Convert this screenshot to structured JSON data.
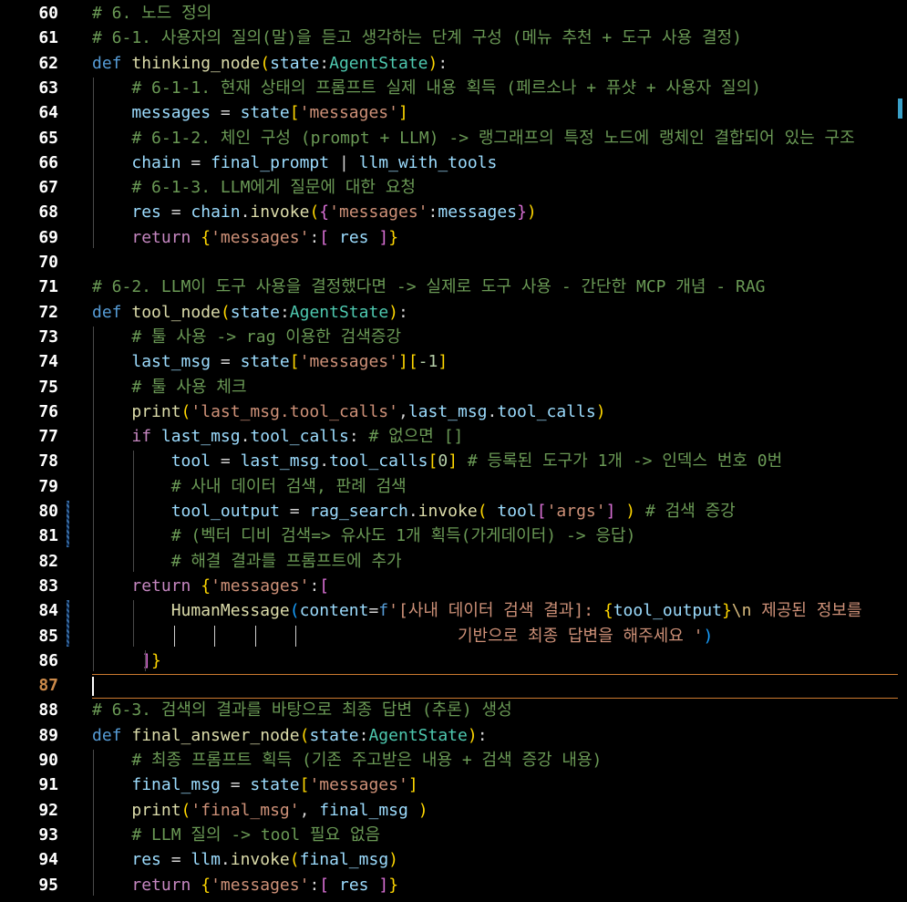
{
  "colors": {
    "background": "#000000",
    "comment": "#6a9955",
    "keyword": "#569cd6",
    "control": "#c586c0",
    "function": "#dcdcaa",
    "variable": "#9cdcfe",
    "class": "#4ec9b0",
    "string": "#ce9178",
    "number": "#b5cea8",
    "current_line_number": "#cc8a4a"
  },
  "editor": {
    "current_line": "87",
    "lines": [
      {
        "n": "60",
        "t": [
          [
            "cm",
            "# 6. 노드 정의"
          ]
        ]
      },
      {
        "n": "61",
        "t": [
          [
            "cm",
            "# 6-1. 사용자의 질의(말)을 듣고 생각하는 단계 구성 (메뉴 추천 + 도구 사용 결정)"
          ]
        ]
      },
      {
        "n": "62",
        "t": [
          [
            "kw",
            "def"
          ],
          [
            "pn",
            " "
          ],
          [
            "fn",
            "thinking_node"
          ],
          [
            "br1",
            "("
          ],
          [
            "vr",
            "state"
          ],
          [
            "pn",
            ":"
          ],
          [
            "cl",
            "AgentState"
          ],
          [
            "br1",
            ")"
          ],
          [
            "pn",
            ":"
          ]
        ]
      },
      {
        "n": "63",
        "t": [
          [
            "pn",
            "    "
          ],
          [
            "cm",
            "# 6-1-1. 현재 상태의 프롬프트 실제 내용 획득 (페르소나 + 퓨샷 + 사용자 질의)"
          ]
        ]
      },
      {
        "n": "64",
        "t": [
          [
            "pn",
            "    "
          ],
          [
            "vr",
            "messages"
          ],
          [
            "pn",
            " = "
          ],
          [
            "vr",
            "state"
          ],
          [
            "br1",
            "["
          ],
          [
            "st",
            "'messages'"
          ],
          [
            "br1",
            "]"
          ]
        ]
      },
      {
        "n": "65",
        "t": [
          [
            "pn",
            "    "
          ],
          [
            "cm",
            "# 6-1-2. 체인 구성 (prompt + LLM) -> 랭그래프의 특정 노드에 랭체인 결합되어 있는 구조"
          ]
        ]
      },
      {
        "n": "66",
        "t": [
          [
            "pn",
            "    "
          ],
          [
            "vr",
            "chain"
          ],
          [
            "pn",
            " = "
          ],
          [
            "vr",
            "final_prompt"
          ],
          [
            "pn",
            " | "
          ],
          [
            "vr",
            "llm_with_tools"
          ]
        ]
      },
      {
        "n": "67",
        "t": [
          [
            "pn",
            "    "
          ],
          [
            "cm",
            "# 6-1-3. LLM에게 질문에 대한 요청"
          ]
        ]
      },
      {
        "n": "68",
        "t": [
          [
            "pn",
            "    "
          ],
          [
            "vr",
            "res"
          ],
          [
            "pn",
            " = "
          ],
          [
            "vr",
            "chain"
          ],
          [
            "pn",
            "."
          ],
          [
            "fn",
            "invoke"
          ],
          [
            "br1",
            "("
          ],
          [
            "br2",
            "{"
          ],
          [
            "st",
            "'messages'"
          ],
          [
            "pn",
            ":"
          ],
          [
            "vr",
            "messages"
          ],
          [
            "br2",
            "}"
          ],
          [
            "br1",
            ")"
          ]
        ]
      },
      {
        "n": "69",
        "t": [
          [
            "pn",
            "    "
          ],
          [
            "kw2",
            "return"
          ],
          [
            "pn",
            " "
          ],
          [
            "br1",
            "{"
          ],
          [
            "st",
            "'messages'"
          ],
          [
            "pn",
            ":"
          ],
          [
            "br2",
            "["
          ],
          [
            "pn",
            " "
          ],
          [
            "vr",
            "res"
          ],
          [
            "pn",
            " "
          ],
          [
            "br2",
            "]"
          ],
          [
            "br1",
            "}"
          ]
        ]
      },
      {
        "n": "70",
        "t": []
      },
      {
        "n": "71",
        "t": [
          [
            "cm",
            "# 6-2. LLM이 도구 사용을 결정했다면 -> 실제로 도구 사용 - 간단한 MCP 개념 - RAG"
          ]
        ]
      },
      {
        "n": "72",
        "t": [
          [
            "kw",
            "def"
          ],
          [
            "pn",
            " "
          ],
          [
            "fn",
            "tool_node"
          ],
          [
            "br1",
            "("
          ],
          [
            "vr",
            "state"
          ],
          [
            "pn",
            ":"
          ],
          [
            "cl",
            "AgentState"
          ],
          [
            "br1",
            ")"
          ],
          [
            "pn",
            ":"
          ]
        ]
      },
      {
        "n": "73",
        "t": [
          [
            "pn",
            "    "
          ],
          [
            "cm",
            "# 툴 사용 -> rag 이용한 검색증강"
          ]
        ]
      },
      {
        "n": "74",
        "t": [
          [
            "pn",
            "    "
          ],
          [
            "vr",
            "last_msg"
          ],
          [
            "pn",
            " = "
          ],
          [
            "vr",
            "state"
          ],
          [
            "br1",
            "["
          ],
          [
            "st",
            "'messages'"
          ],
          [
            "br1",
            "]["
          ],
          [
            "nm",
            "-1"
          ],
          [
            "br1",
            "]"
          ]
        ]
      },
      {
        "n": "75",
        "t": [
          [
            "pn",
            "    "
          ],
          [
            "cm",
            "# 툴 사용 체크"
          ]
        ]
      },
      {
        "n": "76",
        "t": [
          [
            "pn",
            "    "
          ],
          [
            "fn",
            "print"
          ],
          [
            "br1",
            "("
          ],
          [
            "st",
            "'last_msg.tool_calls'"
          ],
          [
            "pn",
            ","
          ],
          [
            "vr",
            "last_msg"
          ],
          [
            "pn",
            "."
          ],
          [
            "vr",
            "tool_calls"
          ],
          [
            "br1",
            ")"
          ]
        ]
      },
      {
        "n": "77",
        "t": [
          [
            "pn",
            "    "
          ],
          [
            "kw2",
            "if"
          ],
          [
            "pn",
            " "
          ],
          [
            "vr",
            "last_msg"
          ],
          [
            "pn",
            "."
          ],
          [
            "vr",
            "tool_calls"
          ],
          [
            "pn",
            ": "
          ],
          [
            "cm",
            "# 없으면 []"
          ]
        ]
      },
      {
        "n": "78",
        "t": [
          [
            "pn",
            "        "
          ],
          [
            "vr",
            "tool"
          ],
          [
            "pn",
            " = "
          ],
          [
            "vr",
            "last_msg"
          ],
          [
            "pn",
            "."
          ],
          [
            "vr",
            "tool_calls"
          ],
          [
            "br1",
            "["
          ],
          [
            "nm",
            "0"
          ],
          [
            "br1",
            "]"
          ],
          [
            "pn",
            " "
          ],
          [
            "cm",
            "# 등록된 도구가 1개 -> 인덱스 번호 0번"
          ]
        ]
      },
      {
        "n": "79",
        "t": [
          [
            "pn",
            "        "
          ],
          [
            "cm",
            "# 사내 데이터 검색, 판례 검색"
          ]
        ]
      },
      {
        "n": "80",
        "t": [
          [
            "pn",
            "        "
          ],
          [
            "vr",
            "tool_output"
          ],
          [
            "pn",
            " = "
          ],
          [
            "vr",
            "rag_search"
          ],
          [
            "pn",
            "."
          ],
          [
            "fn",
            "invoke"
          ],
          [
            "br1",
            "("
          ],
          [
            "pn",
            " "
          ],
          [
            "vr",
            "tool"
          ],
          [
            "br2",
            "["
          ],
          [
            "st",
            "'args'"
          ],
          [
            "br2",
            "]"
          ],
          [
            "pn",
            " "
          ],
          [
            "br1",
            ")"
          ],
          [
            "pn",
            " "
          ],
          [
            "cm",
            "# 검색 증강"
          ]
        ]
      },
      {
        "n": "81",
        "t": [
          [
            "pn",
            "        "
          ],
          [
            "cm",
            "# (벡터 디비 검색=> 유사도 1개 획득(가게데이터) -> 응답)"
          ]
        ]
      },
      {
        "n": "82",
        "t": [
          [
            "pn",
            "        "
          ],
          [
            "cm",
            "# 해결 결과를 프롬프트에 추가"
          ]
        ]
      },
      {
        "n": "83",
        "t": [
          [
            "pn",
            "    "
          ],
          [
            "kw2",
            "return"
          ],
          [
            "pn",
            " "
          ],
          [
            "br1",
            "{"
          ],
          [
            "st",
            "'messages'"
          ],
          [
            "pn",
            ":"
          ],
          [
            "br2",
            "["
          ]
        ]
      },
      {
        "n": "84",
        "t": [
          [
            "pn",
            "        "
          ],
          [
            "fn",
            "HumanMessage"
          ],
          [
            "br3",
            "("
          ],
          [
            "vr",
            "content"
          ],
          [
            "pn",
            "="
          ],
          [
            "kw",
            "f"
          ],
          [
            "st",
            "'[사내 데이터 검색 결과]: "
          ],
          [
            "br1",
            "{"
          ],
          [
            "vr",
            "tool_output"
          ],
          [
            "br1",
            "}"
          ],
          [
            "es",
            "\\n"
          ],
          [
            "st",
            " 제공된 정보를"
          ]
        ]
      },
      {
        "n": "85",
        "t": [
          [
            "pn",
            "                                     "
          ],
          [
            "st",
            "기반으로 최종 답변을 해주세요 '"
          ],
          [
            "br3",
            ")"
          ]
        ]
      },
      {
        "n": "86",
        "t": [
          [
            "pn",
            "     "
          ],
          [
            "br2",
            "]"
          ],
          [
            "br1",
            "}"
          ]
        ]
      },
      {
        "n": "87",
        "t": []
      },
      {
        "n": "88",
        "t": [
          [
            "cm",
            "# 6-3. 검색의 결과를 바탕으로 최종 답변 (추론) 생성"
          ]
        ]
      },
      {
        "n": "89",
        "t": [
          [
            "kw",
            "def"
          ],
          [
            "pn",
            " "
          ],
          [
            "fn",
            "final_answer_node"
          ],
          [
            "br1",
            "("
          ],
          [
            "vr",
            "state"
          ],
          [
            "pn",
            ":"
          ],
          [
            "cl",
            "AgentState"
          ],
          [
            "br1",
            ")"
          ],
          [
            "pn",
            ":"
          ]
        ]
      },
      {
        "n": "90",
        "t": [
          [
            "pn",
            "    "
          ],
          [
            "cm",
            "# 최종 프롬프트 획득 (기존 주고받은 내용 + 검색 증강 내용)"
          ]
        ]
      },
      {
        "n": "91",
        "t": [
          [
            "pn",
            "    "
          ],
          [
            "vr",
            "final_msg"
          ],
          [
            "pn",
            " = "
          ],
          [
            "vr",
            "state"
          ],
          [
            "br1",
            "["
          ],
          [
            "st",
            "'messages'"
          ],
          [
            "br1",
            "]"
          ]
        ]
      },
      {
        "n": "92",
        "t": [
          [
            "pn",
            "    "
          ],
          [
            "fn",
            "print"
          ],
          [
            "br1",
            "("
          ],
          [
            "st",
            "'final_msg'"
          ],
          [
            "pn",
            ", "
          ],
          [
            "vr",
            "final_msg"
          ],
          [
            "pn",
            " "
          ],
          [
            "br1",
            ")"
          ]
        ]
      },
      {
        "n": "93",
        "t": [
          [
            "pn",
            "    "
          ],
          [
            "cm",
            "# LLM 질의 -> tool 필요 없음"
          ]
        ]
      },
      {
        "n": "94",
        "t": [
          [
            "pn",
            "    "
          ],
          [
            "vr",
            "res"
          ],
          [
            "pn",
            " = "
          ],
          [
            "vr",
            "llm"
          ],
          [
            "pn",
            "."
          ],
          [
            "fn",
            "invoke"
          ],
          [
            "br1",
            "("
          ],
          [
            "vr",
            "final_msg"
          ],
          [
            "br1",
            ")"
          ]
        ]
      },
      {
        "n": "95",
        "t": [
          [
            "pn",
            "    "
          ],
          [
            "kw2",
            "return"
          ],
          [
            "pn",
            " "
          ],
          [
            "br1",
            "{"
          ],
          [
            "st",
            "'messages'"
          ],
          [
            "pn",
            ":"
          ],
          [
            "br2",
            "["
          ],
          [
            "pn",
            " "
          ],
          [
            "vr",
            "res"
          ],
          [
            "pn",
            " "
          ],
          [
            "br2",
            "]"
          ],
          [
            "br1",
            "}"
          ]
        ]
      }
    ]
  }
}
